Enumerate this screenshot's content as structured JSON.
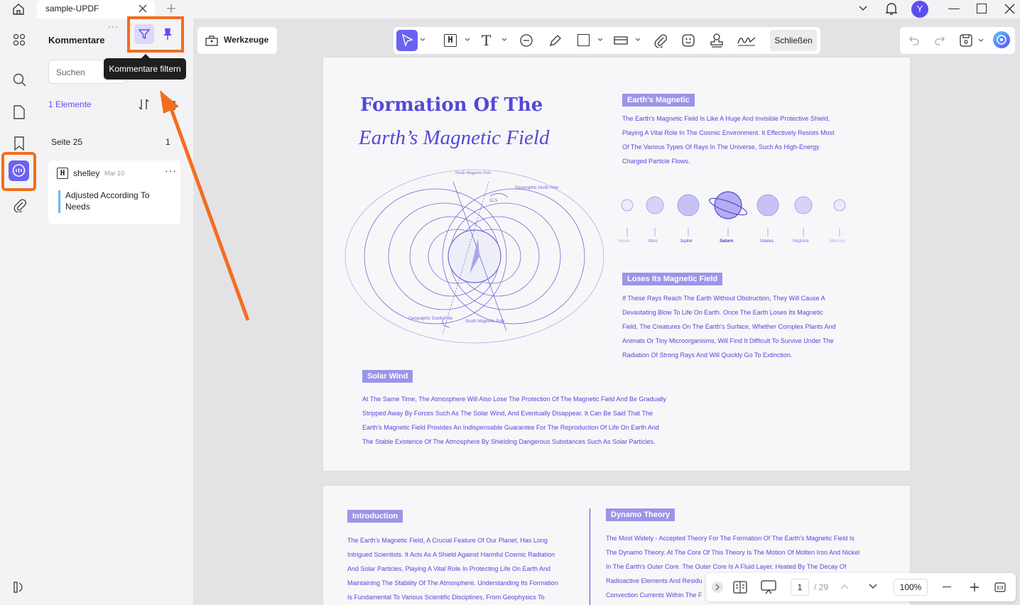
{
  "window": {
    "tab_title": "sample-UPDF",
    "avatar_letter": "Y"
  },
  "panel": {
    "title": "Kommentare",
    "search_placeholder": "Suchen",
    "tooltip": "Kommentare filtern",
    "count": "1 Elemente",
    "page_label": "Seite 25",
    "page_count": "1",
    "comment": {
      "author": "shelley",
      "date": "Mar 10",
      "text": "Adjusted According To Needs"
    }
  },
  "toolbar": {
    "tools_label": "Werkzeuge",
    "close_label": "Schließen"
  },
  "document": {
    "page1": {
      "title_line1": "Formation Of The",
      "title_line2": "Earth’s Magnetic Field",
      "tag1": "Earth's Magnetic",
      "para1": [
        "The Earth's Magnetic Field Is Like A Huge And Invisible Protective Shield,",
        "Playing A Vital Role In The Cosmic Environment. It Effectively Resists Most",
        "Of The Various Types Of Rays In The Universe, Such As High-Energy",
        "Charged Particle Flows."
      ],
      "planets": [
        "Venus",
        "Mars",
        "Jupiter",
        "Saturn",
        "Uranus",
        "Neptune",
        "Mercury"
      ],
      "tag2": "Loses Its Magnetic Field",
      "para2": [
        "If These Rays Reach The Earth Without Obstruction, They Will Cause A",
        "Devastating Blow To Life On Earth. Once The Earth Loses Its Magnetic",
        "Field, The Creatures On The Earth's Surface, Whether Complex Plants And",
        "Animals Or Tiny Microorganisms, Will Find It Difficult To Survive Under The",
        "Radiation Of Strong Rays And Will Quickly Go To Extinction."
      ],
      "tag3": "Solar Wind",
      "para3": [
        "At The Same Time, The Atmosphere Will Also Lose The Protection Of The Magnetic Field And Be Gradually",
        "Stripped Away By Forces Such As The Solar Wind, And Eventually Disappear. It Can Be Said That The",
        "Earth's Magnetic Field Provides An Indispensable Guarantee For The Reproduction Of Life On Earth And",
        "The Stable Existence Of The Atmosphere By Shielding Dangerous Substances Such As Solar Particles."
      ],
      "diagram_labels": {
        "north_mag": "North Magnetic Pole",
        "geo_north": "Geographic North Pole",
        "angle": "11.5",
        "geo_south": "Geographic South Pole",
        "south_mag": "South Magnetic Pole"
      }
    },
    "page2": {
      "tag_left": "Introduction",
      "para_left": [
        "The Earth's Magnetic Field, A Crucial Feature Of Our Planet, Has Long",
        "Intrigued Scientists. It Acts As A Shield Against Harmful Cosmic Radiation",
        "And Solar Particles, Playing A Vital Role In Protecting Life On Earth And",
        "Maintaining The Stability Of The Atmosphere. Understanding Its Formation",
        "Is Fundamental To Various Scientific Disciplines, From Geophysics To"
      ],
      "tag_right": "Dynamo Theory",
      "para_right": [
        "The Most Widely - Accepted Theory For The Formation Of The Earth's Magnetic Field Is",
        "The Dynamo Theory. At The Core Of This Theory Is The Motion Of Molten Iron And Nickel",
        "In The Earth's Outer Core. The Outer Core Is A Fluid Layer, Heated By The Decay Of",
        "Radioactive Elements And Residu",
        "Convection Currents Within The F"
      ]
    }
  },
  "statusbar": {
    "page_current": "1",
    "page_total": "/ 29",
    "zoom": "100%"
  },
  "colors": {
    "accent": "#5b4ff0",
    "highlight": "#f36d1e",
    "doc_text": "#5348d8",
    "tag_bg": "#9b95e8"
  }
}
